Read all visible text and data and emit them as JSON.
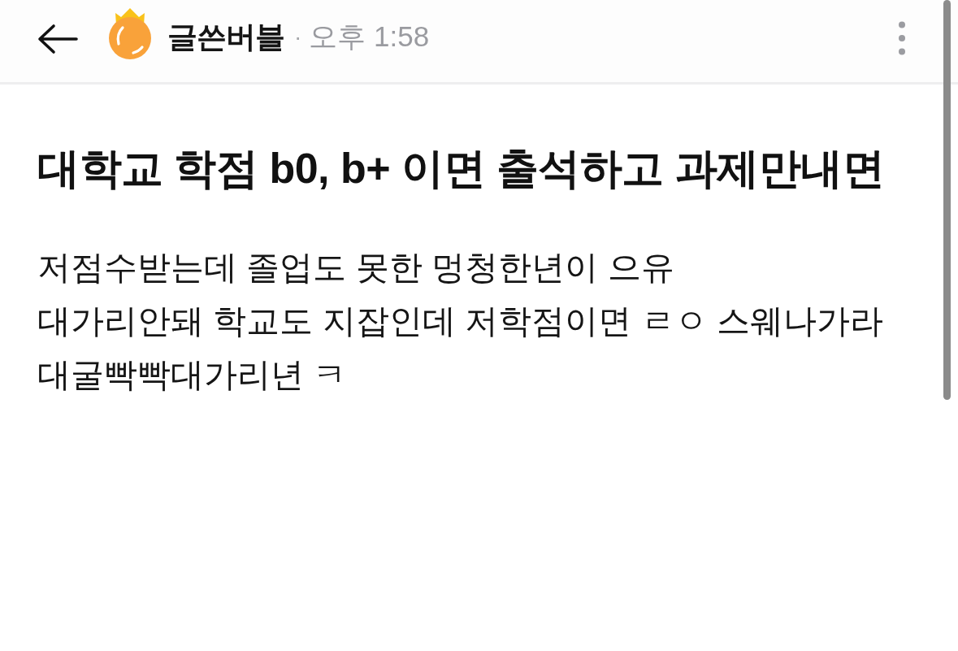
{
  "header": {
    "author": "글쓴버블",
    "separator": "·",
    "time": "오후 1:58"
  },
  "post": {
    "title": "대학교 학점 b0, b+ 이면 출석하고 과제만내면",
    "body_lines": [
      "저점수받는데 졸업도 못한 멍청한년이 으유",
      "대가리안돼 학교도 지잡인데 저학점이면 ㄹㅇ 스웨나가라",
      "대굴빡빡대가리년 ㅋ"
    ]
  }
}
